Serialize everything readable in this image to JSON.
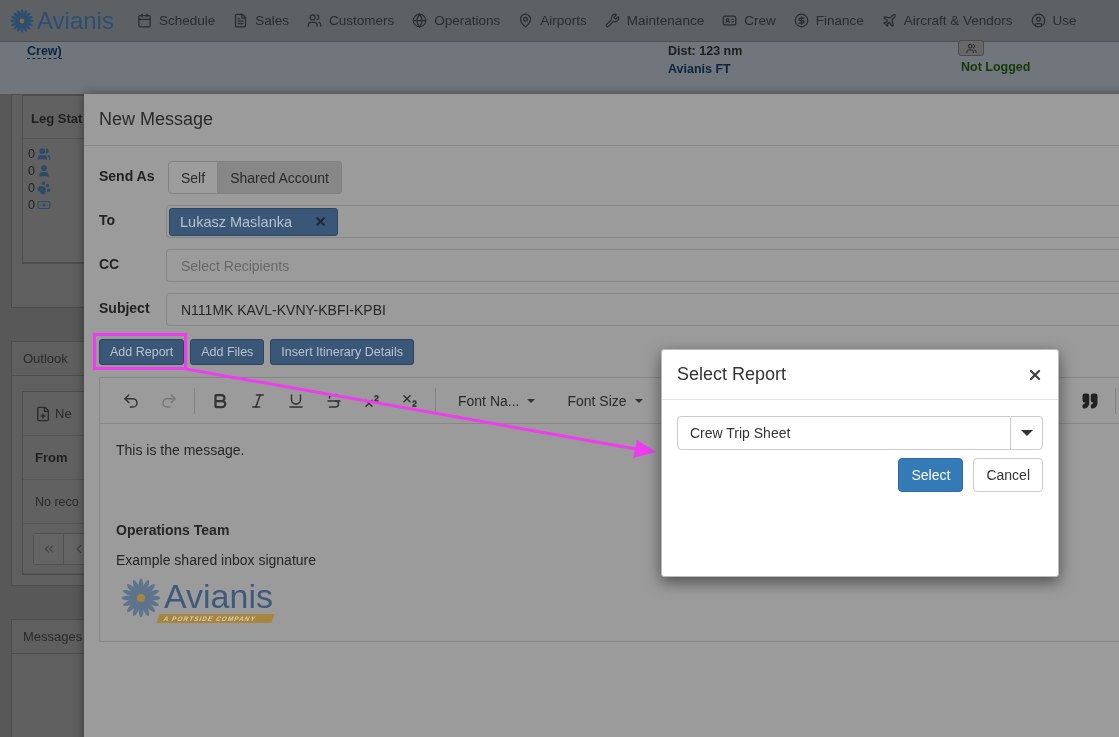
{
  "nav": {
    "brand": "Avianis",
    "items": [
      {
        "label": "Schedule"
      },
      {
        "label": "Sales"
      },
      {
        "label": "Customers"
      },
      {
        "label": "Operations"
      },
      {
        "label": "Airports"
      },
      {
        "label": "Maintenance"
      },
      {
        "label": "Crew"
      },
      {
        "label": "Finance"
      },
      {
        "label": "Aircraft & Vendors"
      },
      {
        "label": "Use"
      }
    ]
  },
  "trip_header": {
    "link": "Crew)",
    "distance": "Dist: 123 nm",
    "operator": "Avianis FT",
    "log_status": "Not Logged"
  },
  "leg_status": {
    "title": "Leg Stat",
    "counts": [
      "0",
      "0",
      "0",
      "0"
    ]
  },
  "outlook": {
    "title": "Outlook",
    "new_button": "Ne",
    "column": "From",
    "empty": "No reco"
  },
  "messages_panel": {
    "title": "Messages"
  },
  "new_message": {
    "title": "New Message",
    "send_as": {
      "label": "Send As",
      "options": [
        {
          "label": "Self",
          "selected": false
        },
        {
          "label": "Shared Account",
          "selected": true
        }
      ]
    },
    "to": {
      "label": "To",
      "recipients": [
        "Lukasz Maslanka"
      ]
    },
    "cc": {
      "label": "CC",
      "placeholder": "Select Recipients"
    },
    "subject": {
      "label": "Subject",
      "value": "N111MK KAVL-KVNY-KBFI-KPBI"
    },
    "actions": [
      {
        "label": "Add Report",
        "highlighted": true
      },
      {
        "label": "Add Files",
        "highlighted": false
      },
      {
        "label": "Insert Itinerary Details",
        "highlighted": false
      }
    ],
    "toolbar": {
      "font_name": "Font Na...",
      "font_size": "Font Size"
    },
    "body": {
      "text": "This is the message.",
      "signature_title": "Operations Team",
      "signature_text": "Example shared inbox signature",
      "logo_name": "Avianis",
      "logo_tagline": "A PORTSIDE COMPANY"
    }
  },
  "select_report": {
    "title": "Select Report",
    "value": "Crew Trip Sheet",
    "buttons": [
      {
        "label": "Select",
        "kind": "primary"
      },
      {
        "label": "Cancel",
        "kind": "default"
      }
    ]
  }
}
